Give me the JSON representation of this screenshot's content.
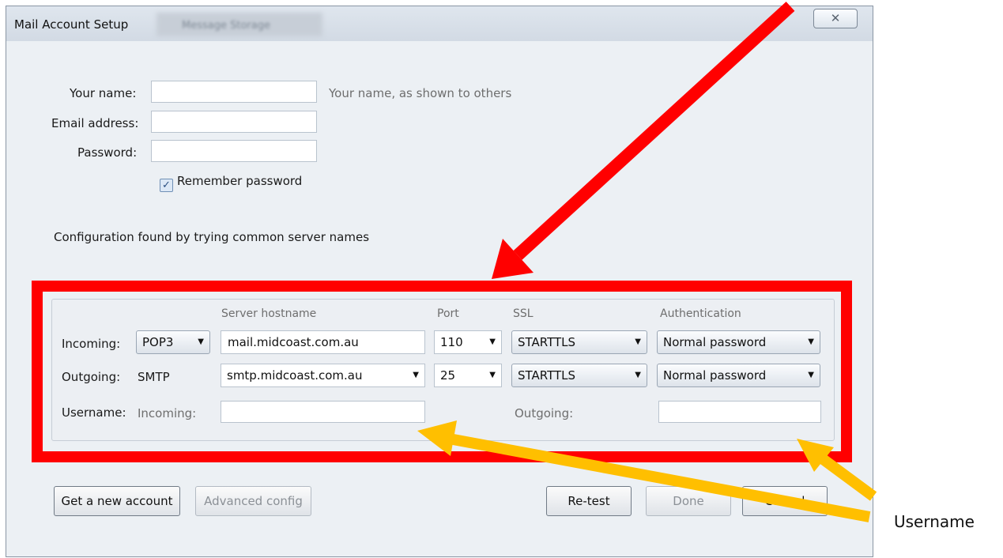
{
  "dialog": {
    "title": "Mail Account Setup",
    "background_tab": "Message Storage",
    "close_glyph": "✕"
  },
  "identity": {
    "your_name_label": "Your name:",
    "your_name_value": "",
    "your_name_hint": "Your name, as shown to others",
    "email_label": "Email address:",
    "email_value": "",
    "password_label": "Password:",
    "password_value": "",
    "remember_label": "Remember password",
    "remember_checked": true
  },
  "status_text": "Configuration found by trying common server names",
  "server_config": {
    "headers": {
      "hostname": "Server hostname",
      "port": "Port",
      "ssl": "SSL",
      "auth": "Authentication"
    },
    "incoming": {
      "label": "Incoming:",
      "protocol": "POP3",
      "hostname": "mail.midcoast.com.au",
      "port": "110",
      "ssl": "STARTTLS",
      "auth": "Normal password"
    },
    "outgoing": {
      "label": "Outgoing:",
      "protocol": "SMTP",
      "hostname": "smtp.midcoast.com.au",
      "port": "25",
      "ssl": "STARTTLS",
      "auth": "Normal password"
    },
    "username": {
      "label": "Username:",
      "incoming_label": "Incoming:",
      "incoming_value": "",
      "outgoing_label": "Outgoing:",
      "outgoing_value": ""
    }
  },
  "buttons": {
    "get_new_account": "Get a new account",
    "advanced_config": "Advanced config",
    "retest": "Re-test",
    "done": "Done",
    "cancel": "Cancel"
  },
  "annotations": {
    "callout": "Username",
    "red_color": "#ff0000",
    "yellow_color": "#ffbf00"
  }
}
